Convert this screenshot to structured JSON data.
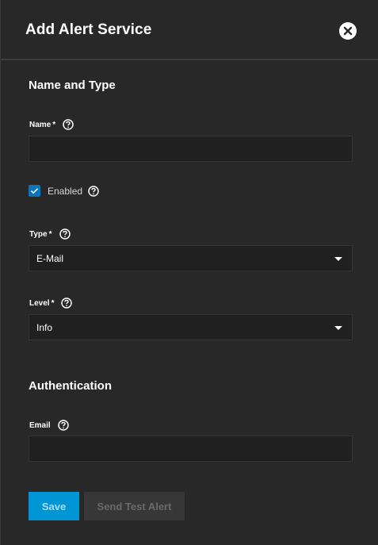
{
  "header": {
    "title": "Add Alert Service",
    "close_icon": "close-circle-icon"
  },
  "sections": {
    "name_type": "Name and Type",
    "authentication": "Authentication"
  },
  "fields": {
    "name": {
      "label": "Name",
      "required_marker": "*",
      "value": "",
      "placeholder": ""
    },
    "enabled": {
      "label": "Enabled",
      "checked": true
    },
    "type": {
      "label": "Type",
      "required_marker": "*",
      "selected": "E-Mail"
    },
    "level": {
      "label": "Level",
      "required_marker": "*",
      "selected": "Info"
    },
    "email": {
      "label": "Email",
      "value": "",
      "placeholder": ""
    }
  },
  "buttons": {
    "save_label": "Save",
    "send_test_label": "Send Test Alert"
  },
  "colors": {
    "background": "#282828",
    "input_background": "#202020",
    "accent": "#0095d5",
    "checkbox": "#0e74b8",
    "disabled_button": "#373737"
  },
  "icons": {
    "help": "help-circle-icon",
    "caret": "caret-down-icon",
    "check": "check-icon"
  }
}
